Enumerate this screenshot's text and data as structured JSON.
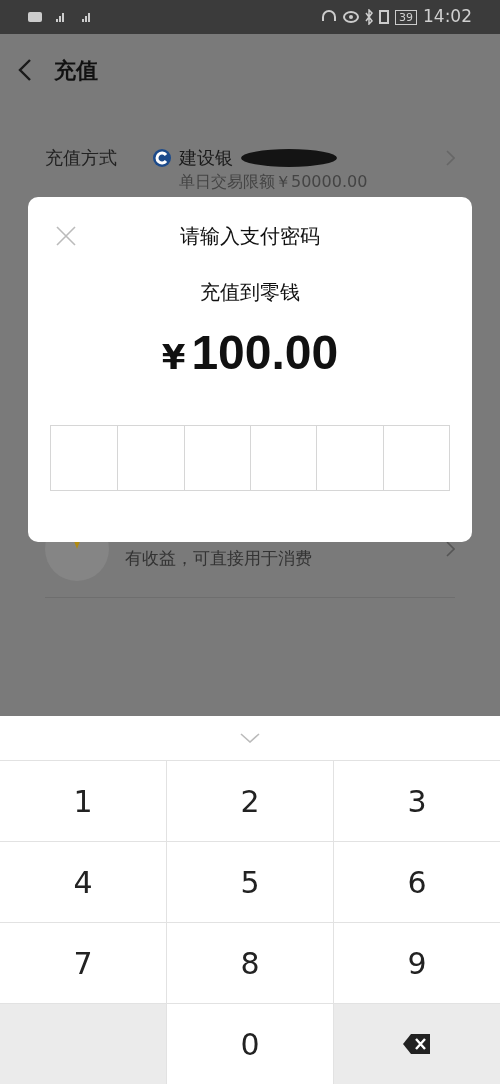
{
  "status_bar": {
    "time": "14:02",
    "battery": "39"
  },
  "header": {
    "title": "充值"
  },
  "method": {
    "label": "充值方式",
    "bank": "建设银",
    "limit": "单日交易限额￥50000.00"
  },
  "option": {
    "subtitle": "有收益，可直接用于消费"
  },
  "dialog": {
    "title": "请输入支付密码",
    "subtitle": "充值到零钱",
    "currency": "¥",
    "amount": "100.00"
  },
  "keypad": {
    "keys": [
      {
        "kind": "digit",
        "label": "1"
      },
      {
        "kind": "digit",
        "label": "2"
      },
      {
        "kind": "digit",
        "label": "3"
      },
      {
        "kind": "digit",
        "label": "4"
      },
      {
        "kind": "digit",
        "label": "5"
      },
      {
        "kind": "digit",
        "label": "6"
      },
      {
        "kind": "digit",
        "label": "7"
      },
      {
        "kind": "digit",
        "label": "8"
      },
      {
        "kind": "digit",
        "label": "9"
      },
      {
        "kind": "blank"
      },
      {
        "kind": "digit",
        "label": "0"
      },
      {
        "kind": "delete"
      }
    ]
  }
}
